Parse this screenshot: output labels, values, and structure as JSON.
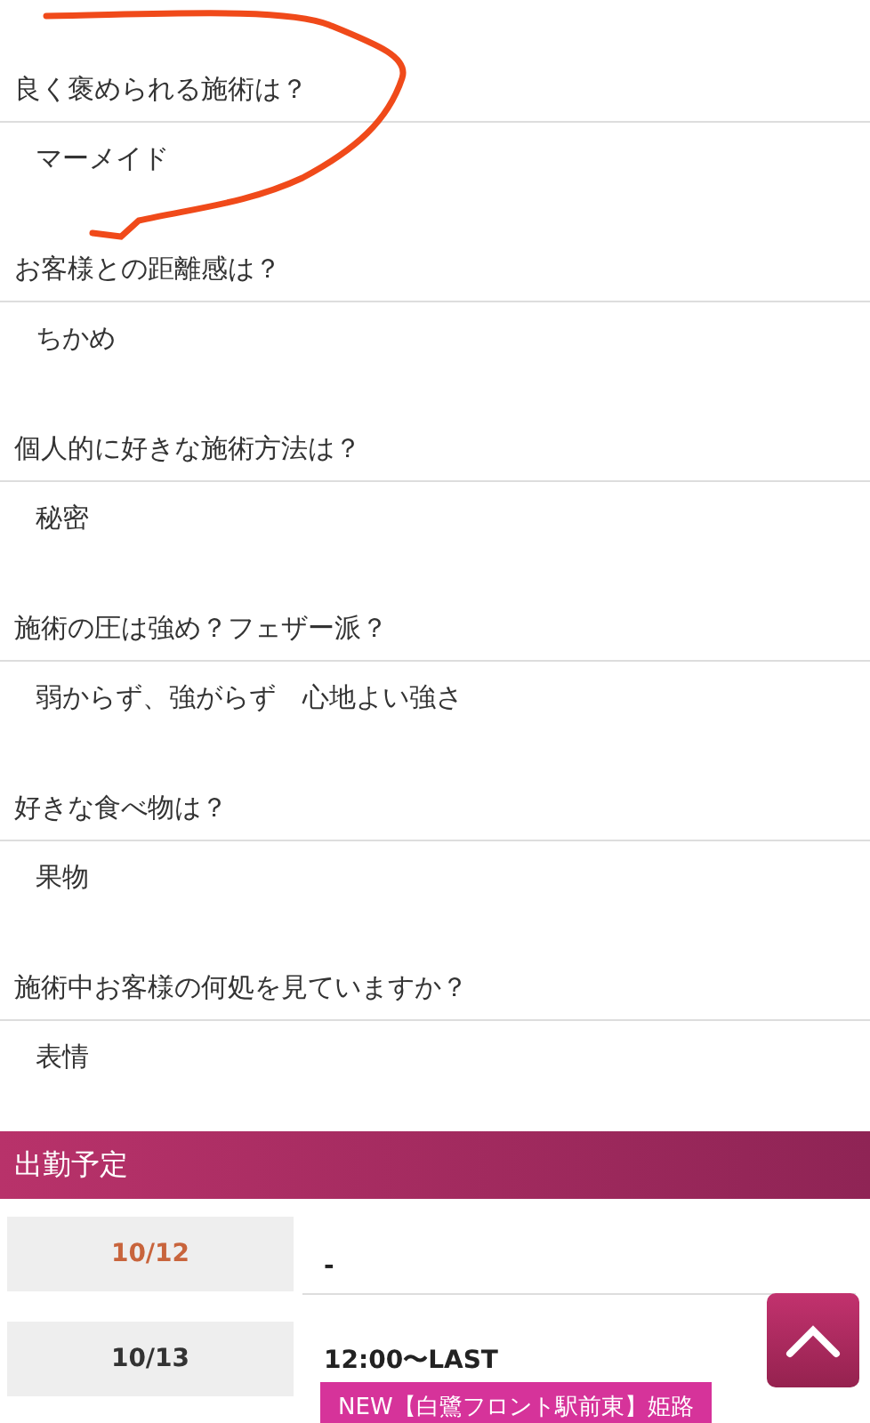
{
  "profile_qa": [
    {
      "question": "良く褒められる施術は？",
      "answer": "マーメイド"
    },
    {
      "question": "お客様との距離感は？",
      "answer": "ちかめ"
    },
    {
      "question": "個人的に好きな施術方法は？",
      "answer": "秘密"
    },
    {
      "question": "施術の圧は強め？フェザー派？",
      "answer": "弱からず、強がらず　心地よい強さ"
    },
    {
      "question": "好きな食べ物は？",
      "answer": "果物"
    },
    {
      "question": "施術中お客様の何処を見ていますか？",
      "answer": "表情"
    }
  ],
  "schedule": {
    "title": "出勤予定",
    "rows": [
      {
        "date": "10/12",
        "today": true,
        "time": "-"
      },
      {
        "date": "10/13",
        "today": false,
        "time": "12:00〜LAST",
        "badge": "NEW【白鷺フロント駅前東】姫路"
      }
    ]
  },
  "annotation": {
    "kind": "scribble",
    "color": "#f04a1a"
  }
}
